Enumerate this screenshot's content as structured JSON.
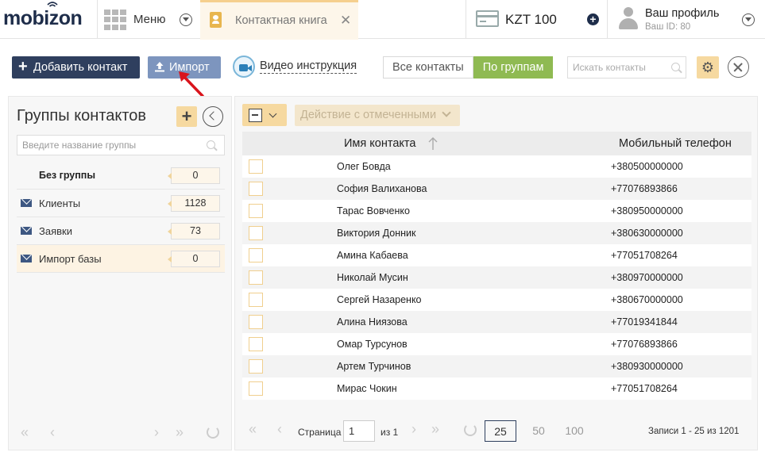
{
  "header": {
    "logo": "mobizon",
    "menu_label": "Меню",
    "tab_label": "Контактная книга",
    "balance": "KZT 100",
    "profile_name": "Ваш профиль",
    "profile_id": "Ваш ID: 80"
  },
  "toolbar": {
    "add_contact": "Добавить контакт",
    "import": "Импорт",
    "video": "Видео инструкция",
    "filter_all": "Все контакты",
    "filter_groups": "По группам",
    "search_placeholder": "Искать контакты"
  },
  "groups_panel": {
    "title": "Группы контактов",
    "search_placeholder": "Введите название группы",
    "groups": [
      {
        "name": "Без группы",
        "count": "0"
      },
      {
        "name": "Клиенты",
        "count": "1128"
      },
      {
        "name": "Заявки",
        "count": "73"
      },
      {
        "name": "Импорт базы",
        "count": "0"
      }
    ]
  },
  "contacts": {
    "action_label": "Действие с отмеченными",
    "col_name": "Имя контакта",
    "col_phone": "Мобильный телефон",
    "rows": [
      {
        "name": "Олег Бовда",
        "phone": "+380500000000"
      },
      {
        "name": "София Валиханова",
        "phone": "+77076893866"
      },
      {
        "name": "Тарас Вовченко",
        "phone": "+380950000000"
      },
      {
        "name": "Виктория Донник",
        "phone": "+380630000000"
      },
      {
        "name": "Амина Кабаева",
        "phone": "+77051708264"
      },
      {
        "name": "Николай Мусин",
        "phone": "+380970000000"
      },
      {
        "name": "Сергей Назаренко",
        "phone": "+380670000000"
      },
      {
        "name": "Алина Ниязова",
        "phone": "+77019341844"
      },
      {
        "name": "Омар Турсунов",
        "phone": "+77076893866"
      },
      {
        "name": "Артем Турчинов",
        "phone": "+380930000000"
      },
      {
        "name": "Мирас Чокин",
        "phone": "+77051708264"
      }
    ]
  },
  "pagination": {
    "page_label": "Страница",
    "page_value": "1",
    "of_label": "из 1",
    "size_25": "25",
    "size_50": "50",
    "size_100": "100",
    "records": "Записи 1 - 25 из 1201"
  },
  "colors": {
    "brand": "#1e2d4a",
    "accent_orange": "#f6d9a0",
    "active_green": "#8fba52",
    "import_blue": "#7d95be",
    "arrow_red": "#d9141c"
  }
}
